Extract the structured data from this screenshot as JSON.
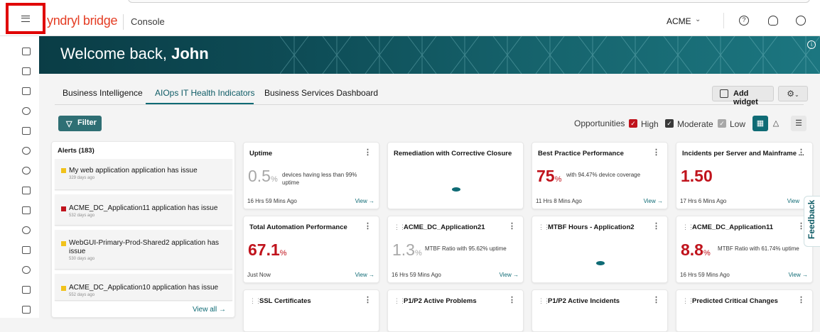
{
  "header": {
    "brand": "yndryl bridge",
    "section": "Console",
    "tenant": "ACME",
    "icons": [
      "menu-icon",
      "help-icon",
      "notification-icon",
      "user-icon"
    ]
  },
  "hero": {
    "greeting": "Welcome back,",
    "name": "John"
  },
  "tabs": [
    {
      "label": "Business Intelligence"
    },
    {
      "label": "AIOps IT Health Indicators",
      "active": true
    },
    {
      "label": "Business Services Dashboard"
    }
  ],
  "toolbar": {
    "add_widget": "Add widget",
    "filter": "Filter"
  },
  "opportunities": {
    "label": "Opportunities",
    "levels": [
      {
        "label": "High",
        "color": "#c0131c",
        "checked": true
      },
      {
        "label": "Moderate",
        "color": "#393939",
        "checked": true
      },
      {
        "label": "Low",
        "color": "#a8a8a8",
        "checked": true
      }
    ]
  },
  "alerts": {
    "title": "Alerts (183)",
    "view_all": "View all →",
    "items": [
      {
        "text": "My web application application has issue",
        "age": "329 days ago",
        "color": "#f1c21b"
      },
      {
        "text": "ACME_DC_Application11 application has issue",
        "age": "532 days ago",
        "color": "#c0131c"
      },
      {
        "text": "WebGUI-Primary-Prod-Shared2 application has issue",
        "age": "530 days ago",
        "color": "#f1c21b"
      },
      {
        "text": "ACME_DC_Application10 application has issue",
        "age": "552 days ago",
        "color": "#f1c21b"
      }
    ]
  },
  "cards": {
    "uptime": {
      "title": "Uptime",
      "value": "0.5",
      "unit": "%",
      "desc": "devices having less than 99% uptime",
      "time": "16 Hrs 59 Mins Ago",
      "view": "View →"
    },
    "remediation": {
      "title": "Remediation with Corrective Closure"
    },
    "best_practice": {
      "title": "Best Practice Performance",
      "value": "75",
      "unit": "%",
      "desc": "with 94.47% device coverage",
      "time": "11 Hrs 8 Mins Ago",
      "view": "View →"
    },
    "incidents_server": {
      "title": "Incidents per Server and Mainframe ...",
      "value": "1.50",
      "time": "17 Hrs 6 Mins Ago",
      "view": "View"
    },
    "automation": {
      "title": "Total Automation Performance",
      "value": "67.1",
      "unit": "%",
      "time": "Just Now",
      "view": "View →"
    },
    "app21": {
      "title": "ACME_DC_Application21",
      "value": "1.3",
      "unit": "%",
      "desc": "MTBF Ratio with 95.62% uptime",
      "time": "16 Hrs 59 Mins Ago",
      "view": "View →"
    },
    "mtbf_app2": {
      "title": "MTBF Hours - Application2"
    },
    "app11": {
      "title": "ACME_DC_Application11",
      "value": "8.8",
      "unit": "%",
      "desc": "MTBF Ratio with 61.74% uptime",
      "time": "16 Hrs 59 Mins Ago",
      "view": "View →"
    },
    "ssl": {
      "title": "SSL Certificates"
    },
    "p1p2_problems": {
      "title": "P1/P2 Active Problems"
    },
    "p1p2_incidents": {
      "title": "P1/P2 Active Incidents"
    },
    "predicted_changes": {
      "title": "Predicted Critical Changes"
    }
  },
  "feedback": "Feedback"
}
